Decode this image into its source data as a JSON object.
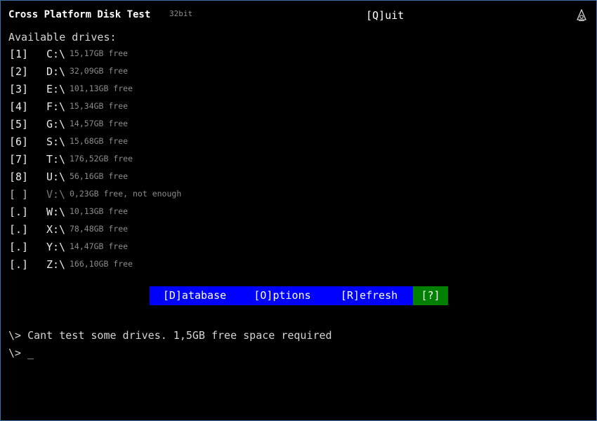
{
  "header": {
    "title": "Cross Platform Disk Test",
    "bits": "32bit",
    "quit_label": "[Q]uit"
  },
  "drives": {
    "heading": "Available drives:",
    "items": [
      {
        "key": "[1]",
        "letter": "C:\\",
        "free": "15,17GB free"
      },
      {
        "key": "[2]",
        "letter": "D:\\",
        "free": "32,09GB free"
      },
      {
        "key": "[3]",
        "letter": "E:\\",
        "free": "101,13GB free"
      },
      {
        "key": "[4]",
        "letter": "F:\\",
        "free": "15,34GB free"
      },
      {
        "key": "[5]",
        "letter": "G:\\",
        "free": "14,57GB free"
      },
      {
        "key": "[6]",
        "letter": "S:\\",
        "free": "15,68GB free"
      },
      {
        "key": "[7]",
        "letter": "T:\\",
        "free": "176,52GB free"
      },
      {
        "key": "[8]",
        "letter": "U:\\",
        "free": "56,16GB free"
      },
      {
        "key": "[ ]",
        "letter": "V:\\",
        "free": "0,23GB free, not enough"
      },
      {
        "key": "[.]",
        "letter": "W:\\",
        "free": "10,13GB free"
      },
      {
        "key": "[.]",
        "letter": "X:\\",
        "free": "78,48GB free"
      },
      {
        "key": "[.]",
        "letter": "Y:\\",
        "free": "14,47GB free"
      },
      {
        "key": "[.]",
        "letter": "Z:\\",
        "free": "166,10GB free"
      }
    ]
  },
  "menu": {
    "database": "[D]atabase",
    "options": "[O]ptions",
    "refresh": "[R]efresh",
    "help": "[?]"
  },
  "console": {
    "message": "\\> Cant test some drives. 1,5GB free space required",
    "prompt": "\\> _"
  },
  "colors": {
    "menu_blue": "#0000ff",
    "help_green": "#008000",
    "border": "#3a6ea5"
  }
}
